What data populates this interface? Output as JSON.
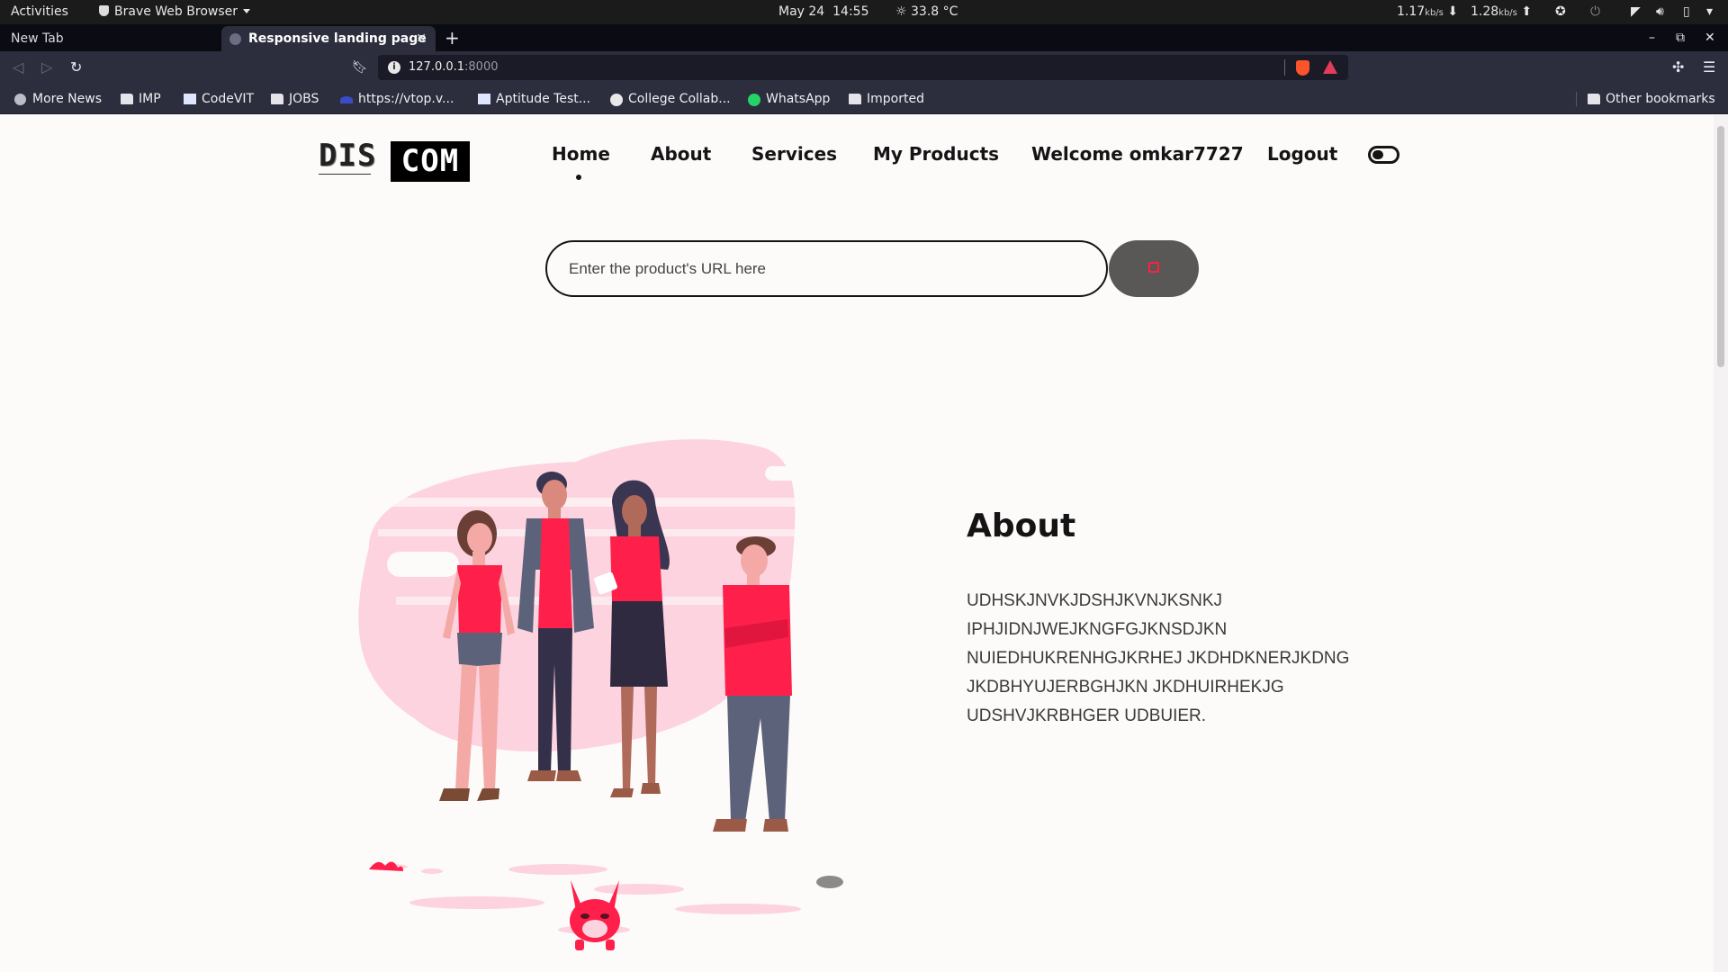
{
  "system_bar": {
    "activities": "Activities",
    "app_menu": "Brave Web Browser",
    "date": "May 24",
    "time": "14:55",
    "weather": "33.8 °C",
    "net_down": "1.17",
    "net_down_unit": "kb/s",
    "net_up": "1.28",
    "net_up_unit": "kb/s"
  },
  "tabs": [
    {
      "title": "New Tab",
      "active": false
    },
    {
      "title": "Responsive landing page",
      "active": true
    }
  ],
  "toolbar": {
    "url_host": "127.0.0.1",
    "url_port": ":8000"
  },
  "bookmarks": [
    {
      "label": "More News",
      "icon": "globe-icon"
    },
    {
      "label": "IMP",
      "icon": "folder-icon"
    },
    {
      "label": "CodeVIT",
      "icon": "doc-icon"
    },
    {
      "label": "JOBS",
      "icon": "folder-icon"
    },
    {
      "label": "https://vtop.v...",
      "icon": "vtop-icon"
    },
    {
      "label": "Aptitude Test...",
      "icon": "doc-icon"
    },
    {
      "label": "College Collab...",
      "icon": "chrome-icon"
    },
    {
      "label": "WhatsApp",
      "icon": "whatsapp-icon"
    },
    {
      "label": "Imported",
      "icon": "folder-icon"
    }
  ],
  "other_bookmarks": "Other bookmarks",
  "page": {
    "logo_left": "DIS",
    "logo_right": "COM",
    "nav": [
      "Home",
      "About",
      "Services",
      "My Products",
      "Welcome omkar7727",
      "Logout"
    ],
    "search_placeholder": "Enter the product's URL here",
    "about_title": "About",
    "about_lines": [
      "UDHSKJNVKJDSHJKVNJKSNKJ",
      "IPHJIDNJWEJKNGFGJKNSDJKN",
      "NUIEDHUKRENHGJKRHEJ JKDHDKNERJKDNG",
      "JKDBHYUJERBGHJKN JKDHUIRHEKJG",
      "UDSHVJKRBHGER UDBUIER."
    ]
  },
  "colors": {
    "accent_pink": "#ff1f4b",
    "blob_pink": "#fcd3de",
    "button_gray": "#5a5757",
    "text_dark": "#141414"
  }
}
